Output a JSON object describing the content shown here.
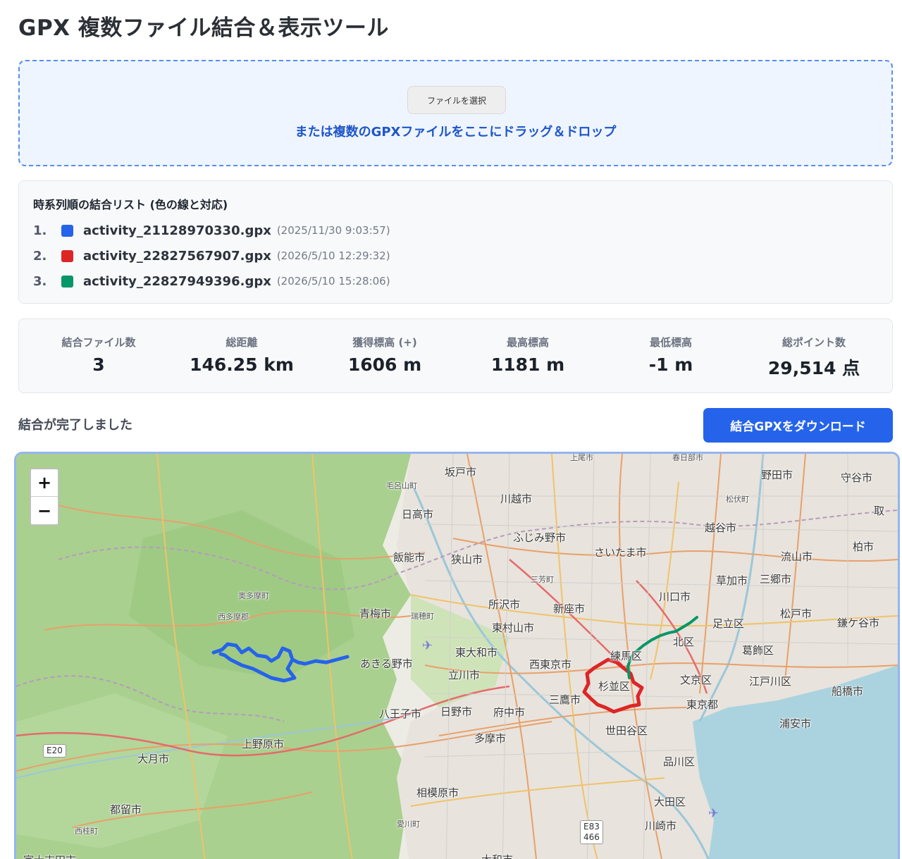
{
  "header": {
    "title": "GPX 複数ファイル結合＆表示ツール"
  },
  "dropzone": {
    "file_button_label": "ファイルを選択",
    "hint": "または複数のGPXファイルをここにドラッグ＆ドロップ"
  },
  "merge_list": {
    "title": "時系列順の結合リスト (色の線と対応)",
    "items": [
      {
        "num": "1.",
        "name": "activity_21128970330.gpx",
        "date": "(2025/11/30 9:03:57)",
        "color": "#2563eb"
      },
      {
        "num": "2.",
        "name": "activity_22827567907.gpx",
        "date": "(2026/5/10 12:29:32)",
        "color": "#dc2626"
      },
      {
        "num": "3.",
        "name": "activity_22827949396.gpx",
        "date": "(2026/5/10 15:28:06)",
        "color": "#059669"
      }
    ]
  },
  "stats": [
    {
      "label": "結合ファイル数",
      "value": "3"
    },
    {
      "label": "総距離",
      "value": "146.25 km"
    },
    {
      "label": "獲得標高 (+)",
      "value": "1606 m"
    },
    {
      "label": "最高標高",
      "value": "1181 m"
    },
    {
      "label": "最低標高",
      "value": "-1 m"
    },
    {
      "label": "総ポイント数",
      "value": "29,514 点"
    }
  ],
  "status": {
    "text": "結合が完了しました",
    "download_label": "結合GPXをダウンロード"
  },
  "map": {
    "zoom_in": "+",
    "zoom_out": "−",
    "labels": {
      "sakado": "坂戸市",
      "moroyama": "毛呂山町",
      "kawagoe": "川越市",
      "noda": "野田市",
      "moriya": "守谷市",
      "matsubushi": "松伏町",
      "hidaka": "日高市",
      "fujimino": "ふじみ野市",
      "koshigaya": "越谷市",
      "toride": "取",
      "hanno": "飯能市",
      "sayama": "狭山市",
      "saitama": "さいたま市",
      "nagareyama": "流山市",
      "kashiwa": "柏市",
      "miyoshi": "三芳町",
      "soka": "草加市",
      "misato": "三郷市",
      "okutama": "奥多摩町",
      "kawaguchi": "川口市",
      "tokorozawa": "所沢市",
      "niiza": "新座市",
      "nishitama": "西多摩郡",
      "ome": "青梅市",
      "mizuho": "瑞穂町",
      "adachi": "足立区",
      "matsudo": "松戸市",
      "kamagaya": "鎌ケ谷市",
      "higashimurayama": "東村山市",
      "kita": "北区",
      "higashiyamato": "東大和市",
      "nerima": "練馬区",
      "katsushika": "葛飾区",
      "akiruno": "あきる野市",
      "nishitokyo": "西東京市",
      "tachikawa": "立川市",
      "suginami": "杉並区",
      "bunkyo": "文京区",
      "edogawa": "江戸川区",
      "funabashi": "船橋市",
      "mitaka": "三鷹市",
      "hachioji": "八王子市",
      "hino": "日野市",
      "fuchu": "府中市",
      "tokyo": "東京都",
      "urayasu": "浦安市",
      "setagaya": "世田谷区",
      "tama": "多摩市",
      "uenohara": "上野原市",
      "otsuki": "大月市",
      "shinagawa": "品川区",
      "sagamihara": "相模原市",
      "ota": "大田区",
      "tsuru": "都留市",
      "aikawa": "愛川町",
      "kawasaki": "川崎市",
      "nishikatsura": "西桂町",
      "yamato": "大和市",
      "fujiyoshida": "富士吉田市",
      "top1": "上尾市",
      "top2": "春日部市"
    },
    "shields": {
      "e20": "E20",
      "e83": "E83\n466"
    },
    "route_colors": {
      "blue": "#2563eb",
      "red": "#dc2626",
      "green": "#059669"
    }
  }
}
